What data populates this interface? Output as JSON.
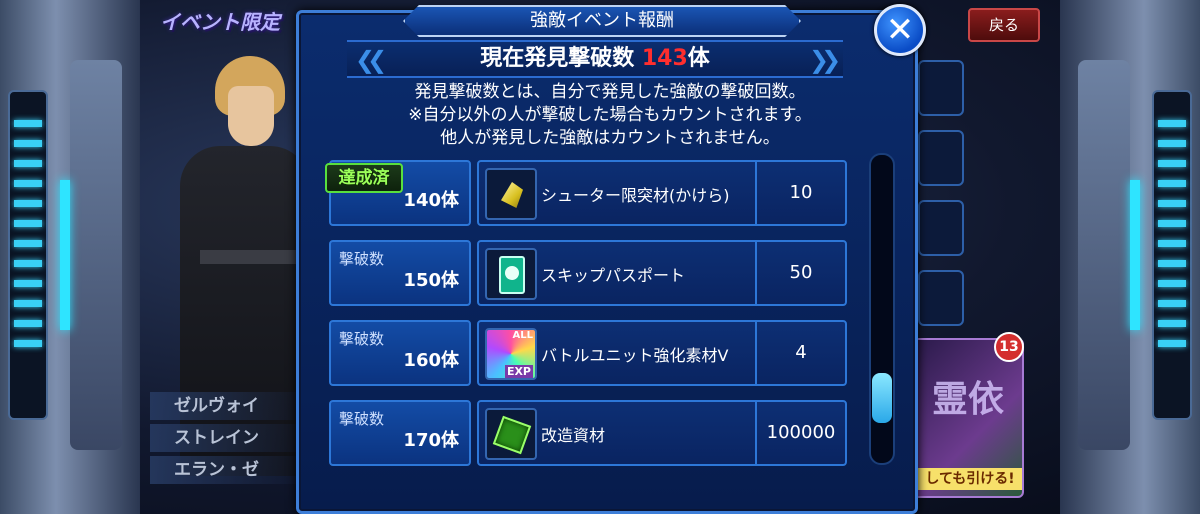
{
  "background": {
    "event_title": "イベント限定",
    "back_button": "戻る",
    "menu_items": [
      "ゼルヴォイ",
      "ストレイン",
      "エラン・ゼ"
    ],
    "banner_text": "しても引ける!",
    "banner_badge": "13",
    "banner_glyphs": "霊依"
  },
  "dialog": {
    "title": "強敵イベント報酬",
    "close_icon": "✕",
    "count_prefix": "現在発見撃破数 ",
    "count_value": "143",
    "count_suffix": "体",
    "description": [
      "発見撃破数とは、自分で発見した強敵の撃破回数。",
      "※自分以外の人が撃破した場合もカウントされます。",
      "他人が発見した強敵はカウントされません。"
    ],
    "rewards": [
      {
        "caption": "",
        "threshold": "140体",
        "achieved_label": "達成済",
        "item": "シューター限突材(かけら)",
        "qty": "10",
        "icon": "crystal-icon"
      },
      {
        "caption": "撃破数",
        "threshold": "150体",
        "item": "スキップパスポート",
        "qty": "50",
        "icon": "passport-icon"
      },
      {
        "caption": "撃破数",
        "threshold": "160体",
        "item": "バトルユニット強化素材V",
        "qty": "4",
        "icon": "exp-material-icon",
        "icon_tag": "ALL",
        "icon_badge": "EXP"
      },
      {
        "caption": "撃破数",
        "threshold": "170体",
        "item": "改造資材",
        "qty": "100000",
        "icon": "cube-icon"
      }
    ],
    "scroll_position": 0.85
  }
}
